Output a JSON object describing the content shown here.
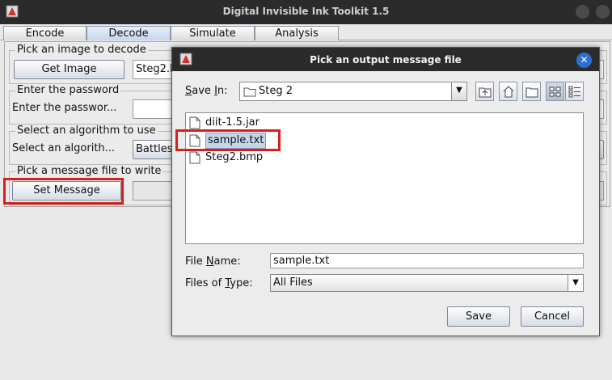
{
  "window": {
    "title": "Digital Invisible Ink Toolkit 1.5"
  },
  "tabs": [
    {
      "label": "Encode",
      "active": false
    },
    {
      "label": "Decode",
      "active": true
    },
    {
      "label": "Simulate",
      "active": false
    },
    {
      "label": "Analysis",
      "active": false
    }
  ],
  "decode": {
    "image_group": {
      "legend": "Pick an image to decode",
      "button": "Get Image",
      "value": "Steg2.bmp"
    },
    "password_group": {
      "legend": "Enter the password",
      "label": "Enter the passwor...",
      "value": ""
    },
    "algorithm_group": {
      "legend": "Select an algorithm to use",
      "label": "Select an algorith...",
      "value": "Battlesteg"
    },
    "message_group": {
      "legend": "Pick a message file to write",
      "button": "Set Message",
      "value": ""
    }
  },
  "dialog": {
    "title": "Pick an output message file",
    "save_in_label": "Save In:",
    "save_in_value": "Steg 2",
    "files": [
      {
        "name": "diit-1.5.jar",
        "selected": false
      },
      {
        "name": "sample.txt",
        "selected": true
      },
      {
        "name": "Steg2.bmp",
        "selected": false
      }
    ],
    "file_name_label": "File Name:",
    "file_name_value": "sample.txt",
    "files_of_type_label": "Files of Type:",
    "files_of_type_value": "All Files",
    "save_button": "Save",
    "cancel_button": "Cancel",
    "toolbar_icons": [
      "up-folder-icon",
      "home-icon",
      "new-folder-icon",
      "list-view-icon",
      "details-view-icon"
    ]
  },
  "colors": {
    "highlight": "#d81e1e",
    "selection": "#c6d6ea",
    "close_button": "#2d6fd0"
  }
}
